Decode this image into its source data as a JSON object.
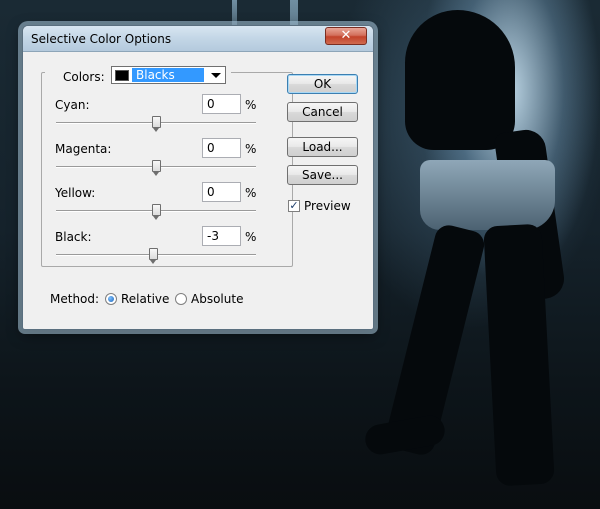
{
  "window": {
    "title": "Selective Color Options",
    "close_glyph": "✕"
  },
  "colors": {
    "label": "Colors:",
    "selected": "Blacks"
  },
  "channels": [
    {
      "label": "Cyan:",
      "value": "0",
      "unit": "%",
      "slider_fraction": 0.5
    },
    {
      "label": "Magenta:",
      "value": "0",
      "unit": "%",
      "slider_fraction": 0.5
    },
    {
      "label": "Yellow:",
      "value": "0",
      "unit": "%",
      "slider_fraction": 0.5
    },
    {
      "label": "Black:",
      "value": "-3",
      "unit": "%",
      "slider_fraction": 0.485
    }
  ],
  "method": {
    "label": "Method:",
    "options": [
      {
        "label": "Relative",
        "selected": true
      },
      {
        "label": "Absolute",
        "selected": false
      }
    ]
  },
  "buttons": {
    "ok": "OK",
    "cancel": "Cancel",
    "load": "Load...",
    "save": "Save..."
  },
  "preview": {
    "label": "Preview",
    "checked": true,
    "check_glyph": "✓"
  },
  "colors_palette": {
    "selection_highlight": "#3399ff",
    "title_bar": "#c3d6e6",
    "close_button": "#c2422a"
  },
  "icons": {
    "close": "close-icon",
    "dropdown": "chevron-down-icon",
    "check": "check-icon"
  }
}
